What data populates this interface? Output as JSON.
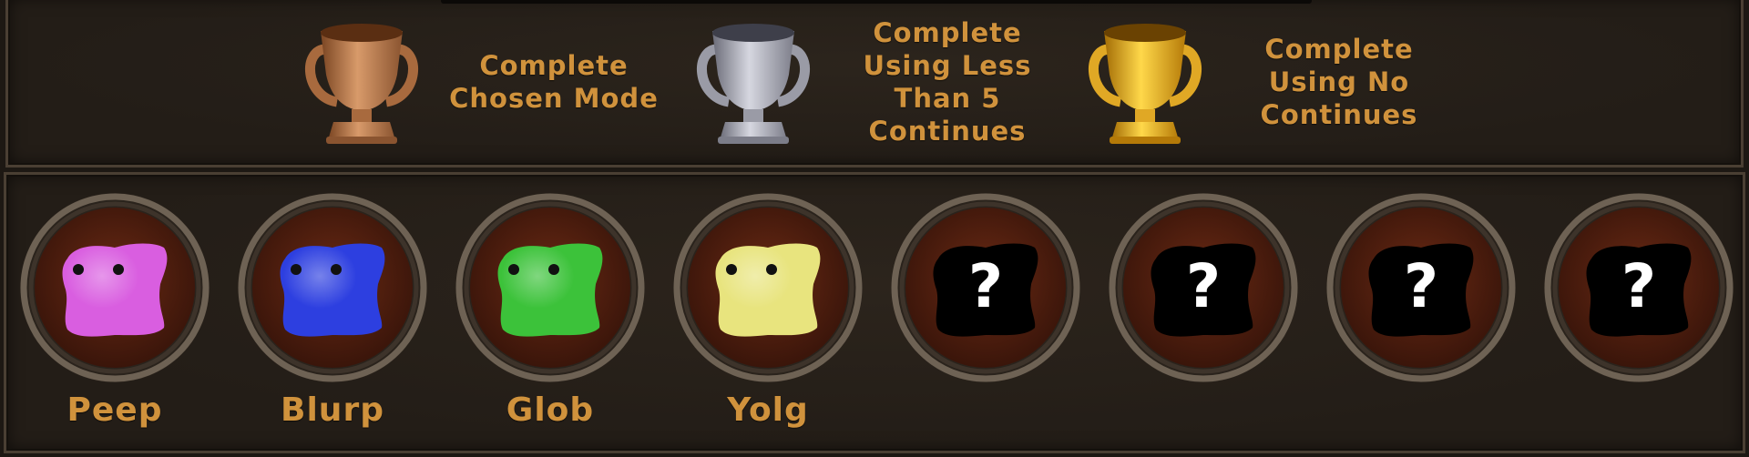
{
  "trophies": [
    {
      "name": "bronze",
      "text": "Complete Chosen Mode",
      "lines": [
        "Complete",
        "Chosen Mode"
      ],
      "color": "#b87a4e"
    },
    {
      "name": "silver",
      "text": "Complete Using Less Than 5 Continues",
      "lines": [
        "Complete",
        "Using Less",
        "Than 5",
        "Continues"
      ],
      "color": "#9a9ba6"
    },
    {
      "name": "gold",
      "text": "Complete Using No Continues",
      "lines": [
        "Complete",
        "Using No",
        "Continues"
      ],
      "color": "#e0a825"
    }
  ],
  "characters": [
    {
      "name": "Peep",
      "color": "#d95ee0",
      "unlocked": true
    },
    {
      "name": "Blurp",
      "color": "#2d3fe0",
      "unlocked": true
    },
    {
      "name": "Glob",
      "color": "#3cc23a",
      "unlocked": true
    },
    {
      "name": "Yolg",
      "color": "#e8e47e",
      "unlocked": true
    },
    {
      "name": "",
      "color": "#000000",
      "unlocked": false,
      "symbol": "?"
    },
    {
      "name": "",
      "color": "#000000",
      "unlocked": false,
      "symbol": "?"
    },
    {
      "name": "",
      "color": "#000000",
      "unlocked": false,
      "symbol": "?"
    },
    {
      "name": "",
      "color": "#000000",
      "unlocked": false,
      "symbol": "?"
    }
  ],
  "colors": {
    "label": "#d0923c",
    "panel_bg": "#231d17",
    "frame": "#4a3f33"
  }
}
